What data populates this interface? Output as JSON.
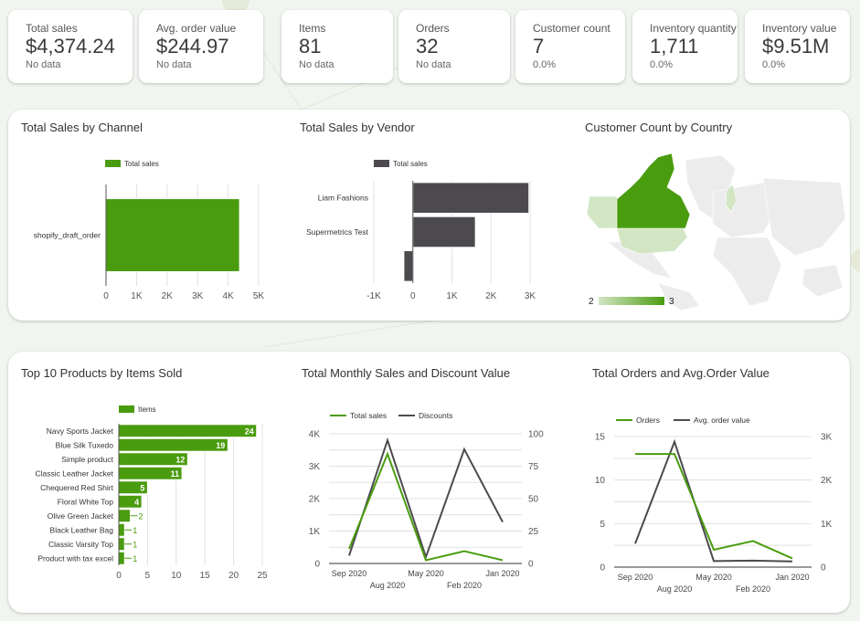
{
  "kpis": [
    {
      "label": "Total sales",
      "value": "$4,374.24",
      "sub": "No data"
    },
    {
      "label": "Avg. order value",
      "value": "$244.97",
      "sub": "No data"
    },
    {
      "label": "Items",
      "value": "81",
      "sub": "No data"
    },
    {
      "label": "Orders",
      "value": "32",
      "sub": "No data"
    },
    {
      "label": "Customer count",
      "value": "7",
      "sub": "0.0%"
    },
    {
      "label": "Inventory quantity",
      "value": "1,711",
      "sub": "0.0%"
    },
    {
      "label": "Inventory value",
      "value": "$9.51M",
      "sub": "0.0%"
    }
  ],
  "colors": {
    "green": "#4a9c0f",
    "dark": "#4d4a4f",
    "grid": "#e0e0e0",
    "mapbase": "#eeeeee",
    "maplight": "#d3e6c4"
  },
  "chart_data": [
    {
      "id": "channel",
      "type": "bar",
      "orientation": "horizontal",
      "title": "Total Sales by Channel",
      "legend": [
        "Total sales"
      ],
      "categories": [
        "shopify_draft_order"
      ],
      "values": [
        4374.24
      ],
      "xlim": [
        0,
        5000
      ],
      "xticks": [
        0,
        1000,
        2000,
        3000,
        4000,
        5000
      ],
      "xtick_labels": [
        "0",
        "1K",
        "2K",
        "3K",
        "4K",
        "5K"
      ],
      "color": "#4a9c0f"
    },
    {
      "id": "vendor",
      "type": "bar",
      "orientation": "horizontal",
      "title": "Total Sales by Vendor",
      "legend": [
        "Total sales"
      ],
      "categories": [
        "Liam Fashions",
        "Supermetrics Test",
        ""
      ],
      "values": [
        2970,
        1600,
        -230
      ],
      "xlim": [
        -1000,
        3000
      ],
      "xticks": [
        -1000,
        0,
        1000,
        2000,
        3000
      ],
      "xtick_labels": [
        "-1K",
        "0",
        "1K",
        "2K",
        "3K"
      ],
      "color": "#4d4a4f"
    },
    {
      "id": "country",
      "type": "heatmap",
      "subtype": "geo-map",
      "title": "Customer Count by Country",
      "regions": [
        {
          "name": "Canada",
          "value": 3
        },
        {
          "name": "United States",
          "value": 2
        },
        {
          "name": "Finland",
          "value": 2
        }
      ],
      "scale": {
        "min": 2,
        "max": 3,
        "min_label": "2",
        "max_label": "3"
      }
    },
    {
      "id": "products",
      "type": "bar",
      "orientation": "horizontal",
      "title": "Top 10 Products by Items Sold",
      "legend": [
        "Items"
      ],
      "categories": [
        "Navy Sports Jacket",
        "Blue Silk Tuxedo",
        "Simple product",
        "Classic Leather Jacket",
        "Chequered Red Shirt",
        "Floral White Top",
        "Olive Green Jacket",
        "Black Leather Bag",
        "Classic Varsity Top",
        "Product with tax excel"
      ],
      "values": [
        24,
        19,
        12,
        11,
        5,
        4,
        2,
        1,
        1,
        1
      ],
      "data_labels": [
        "24",
        "19",
        "12",
        "11",
        "5",
        "4",
        "2",
        "1",
        "1",
        "1"
      ],
      "xlim": [
        0,
        25
      ],
      "xticks": [
        0,
        5,
        10,
        15,
        20,
        25
      ],
      "xtick_labels": [
        "0",
        "5",
        "10",
        "15",
        "20",
        "25"
      ],
      "color": "#4a9c0f"
    },
    {
      "id": "monthly",
      "type": "line",
      "title": "Total Monthly Sales and Discount Value",
      "x": [
        "Sep 2020",
        "Aug 2020",
        "May 2020",
        "Feb 2020",
        "Jan 2020"
      ],
      "x_label_rows": [
        0,
        1,
        0,
        1,
        0
      ],
      "series": [
        {
          "name": "Total sales",
          "axis": "left",
          "values": [
            450,
            3380,
            100,
            380,
            100
          ],
          "color": "#4a9c0f"
        },
        {
          "name": "Discounts",
          "axis": "right",
          "values": [
            6,
            95,
            5,
            88,
            32
          ],
          "color": "#4d4a4f"
        }
      ],
      "ylim_left": [
        0,
        4000
      ],
      "yticks_left": [
        0,
        1000,
        2000,
        3000,
        4000
      ],
      "ytick_labels_left": [
        "0",
        "1K",
        "2K",
        "3K",
        "4K"
      ],
      "ylim_right": [
        0,
        100
      ],
      "yticks_right": [
        0,
        25,
        50,
        75,
        100
      ],
      "ytick_labels_right": [
        "0",
        "25",
        "50",
        "75",
        "100"
      ],
      "grid": true,
      "legend": "top"
    },
    {
      "id": "orders",
      "type": "line",
      "title": "Total Orders and Avg.Order Value",
      "x": [
        "Sep 2020",
        "Aug 2020",
        "May 2020",
        "Feb 2020",
        "Jan 2020"
      ],
      "x_label_rows": [
        0,
        1,
        0,
        1,
        0
      ],
      "series": [
        {
          "name": "Orders",
          "axis": "left",
          "values": [
            13,
            13,
            2,
            3,
            1
          ],
          "color": "#4a9c0f"
        },
        {
          "name": "Avg. order value",
          "axis": "right",
          "values": [
            540,
            2880,
            140,
            150,
            130
          ],
          "color": "#4d4a4f"
        }
      ],
      "ylim_left": [
        0,
        15
      ],
      "yticks_left": [
        0,
        5,
        10,
        15
      ],
      "ytick_labels_left": [
        "0",
        "5",
        "10",
        "15"
      ],
      "ylim_right": [
        0,
        3000
      ],
      "yticks_right": [
        0,
        1000,
        2000,
        3000
      ],
      "ytick_labels_right": [
        "0",
        "1K",
        "2K",
        "3K"
      ],
      "grid": true,
      "legend": "top"
    }
  ]
}
